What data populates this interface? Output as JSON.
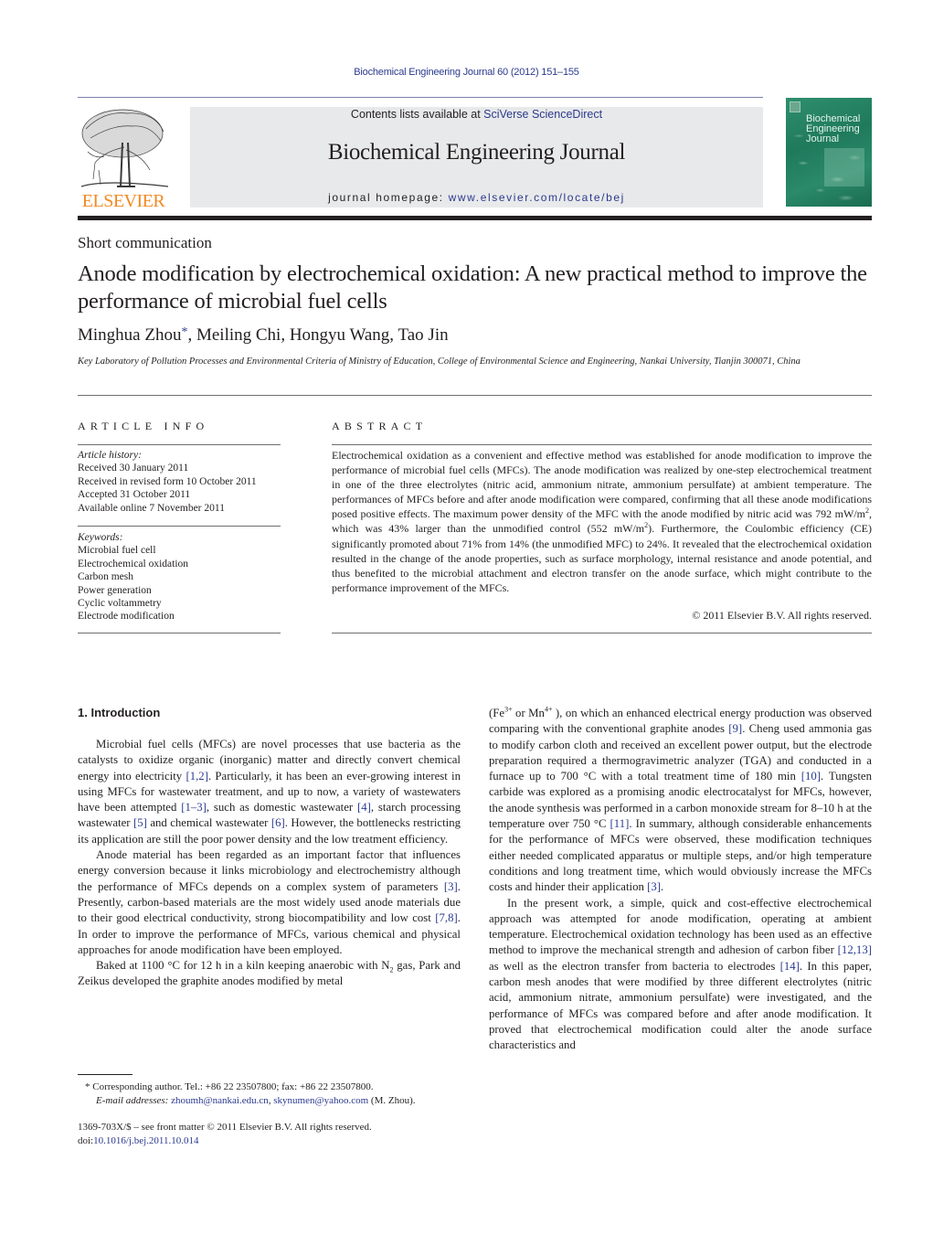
{
  "running_head": "Biochemical Engineering Journal 60 (2012) 151–155",
  "masthead": {
    "contents_prefix": "Contents lists available at ",
    "contents_link": "SciVerse ScienceDirect",
    "journal_title": "Biochemical Engineering Journal",
    "homepage_prefix": "journal homepage: ",
    "homepage_link": "www.elsevier.com/locate/bej",
    "publisher_logo_text": "ELSEVIER",
    "cover_title_lines": [
      "Biochemical",
      "Engineering",
      "Journal"
    ]
  },
  "colors": {
    "link": "#2b3a8f",
    "elsevier_orange": "#f08a24",
    "masthead_bg": "#e8e9ea",
    "cover_green": "#1f7a5c"
  },
  "article": {
    "type": "Short communication",
    "title": "Anode modification by electrochemical oxidation: A new practical method to improve the performance of microbial fuel cells",
    "authors_first": "Minghua Zhou",
    "author_mark": "*",
    "authors_rest": ", Meiling Chi, Hongyu Wang, Tao Jin",
    "affiliation": "Key Laboratory of Pollution Processes and Environmental Criteria of Ministry of Education, College of Environmental Science and Engineering, Nankai University, Tianjin 300071, China"
  },
  "article_info": {
    "heading": "ARTICLE INFO",
    "history_label": "Article history:",
    "history": [
      "Received 30 January 2011",
      "Received in revised form 10 October 2011",
      "Accepted 31 October 2011",
      "Available online 7 November 2011"
    ],
    "keywords_label": "Keywords:",
    "keywords": [
      "Microbial fuel cell",
      "Electrochemical oxidation",
      "Carbon mesh",
      "Power generation",
      "Cyclic voltammetry",
      "Electrode modification"
    ]
  },
  "abstract": {
    "heading": "ABSTRACT",
    "text_1": "Electrochemical oxidation as a convenient and effective method was established for anode modification to improve the performance of microbial fuel cells (MFCs). The anode modification was realized by one-step electrochemical treatment in one of the three electrolytes (nitric acid, ammonium nitrate, ammonium persulfate) at ambient temperature. The performances of MFCs before and after anode modification were compared, confirming that all these anode modifications posed positive effects. The maximum power density of the MFC with the anode modified by nitric acid was 792 mW/m",
    "sup_1": "2",
    "text_2": ", which was 43% larger than the unmodified control (552 mW/m",
    "sup_2": "2",
    "text_3": "). Furthermore, the Coulombic efficiency (CE) significantly promoted about 71% from 14% (the unmodified MFC) to 24%. It revealed that the electrochemical oxidation resulted in the change of the anode properties, such as surface morphology, internal resistance and anode potential, and thus benefited to the microbial attachment and electron transfer on the anode surface, which might contribute to the performance improvement of the MFCs.",
    "copyright": "© 2011 Elsevier B.V. All rights reserved."
  },
  "introduction": {
    "heading": "1.  Introduction",
    "p1": {
      "a": "Microbial fuel cells (MFCs) are novel processes that use bacteria as the catalysts to oxidize organic (inorganic) matter and directly convert chemical energy into electricity ",
      "r1": "[1,2]",
      "b": ". Particularly, it has been an ever-growing interest in using MFCs for wastewater treatment, and up to now, a variety of wastewaters have been attempted ",
      "r2": "[1–3]",
      "c": ", such as domestic wastewater ",
      "r3": "[4]",
      "d": ", starch processing wastewater ",
      "r4": "[5]",
      "e": " and chemical wastewater ",
      "r5": "[6]",
      "f": ". However, the bottlenecks restricting its application are still the poor power density and the low treatment efficiency."
    },
    "p2": {
      "a": "Anode material has been regarded as an important factor that influences energy conversion because it links microbiology and electrochemistry although the performance of MFCs depends on a complex system of parameters ",
      "r1": "[3]",
      "b": ". Presently, carbon-based materials are the most widely used anode materials due to their good electrical conductivity, strong biocompatibility and low cost ",
      "r2": "[7,8]",
      "c": ". In order to improve the performance of MFCs, various chemical and physical approaches for anode modification have been employed."
    },
    "p3": {
      "a": "Baked at 1100 °C for 12 h in a kiln keeping anaerobic with N",
      "sub": "2",
      "b": " gas, Park and Zeikus developed the graphite anodes modified by metal (Fe",
      "sup1": "3+",
      "c": " or Mn",
      "sup2": "4+",
      "d": " ), on which an enhanced electrical energy production was observed comparing with the conventional graphite anodes ",
      "r1": "[9]",
      "e": ". Cheng used ammonia gas to modify carbon cloth and received an excellent power output, but the electrode preparation required a thermogravimetric analyzer (TGA) and conducted in a furnace up to 700 °C with a total treatment time of 180 min ",
      "r2": "[10]",
      "f": ". Tungsten carbide was explored as a promising anodic electrocatalyst for MFCs, however, the anode synthesis was performed in a carbon monoxide stream for 8–10 h at the temperature over 750 °C ",
      "r3": "[11]",
      "g": ". In summary, although considerable enhancements for the performance of MFCs were observed, these modification techniques either needed complicated apparatus or multiple steps, and/or high temperature conditions and long treatment time, which would obviously increase the MFCs costs and hinder their application ",
      "r4": "[3]",
      "h": "."
    },
    "p4": {
      "a": "In the present work, a simple, quick and cost-effective electrochemical approach was attempted for anode modification, operating at ambient temperature. Electrochemical oxidation technology has been used as an effective method to improve the mechanical strength and adhesion of carbon fiber ",
      "r1": "[12,13]",
      "b": " as well as the electron transfer from bacteria to electrodes ",
      "r2": "[14]",
      "c": ". In this paper, carbon mesh anodes that were modified by three different electrolytes (nitric acid, ammonium nitrate, ammonium persulfate) were investigated, and the performance of MFCs was compared before and after anode modification. It proved that electrochemical modification could alter the anode surface characteristics and"
    }
  },
  "footnote": {
    "mark": "*",
    "line1": " Corresponding author. Tel.: +86 22 23507800; fax: +86 22 23507800.",
    "email_label": "E-mail addresses:",
    "email1": "zhoumh@nankai.edu.cn",
    "sep": ", ",
    "email2": "skynumen@yahoo.com",
    "email_suffix": " (M. Zhou)."
  },
  "front_matter": {
    "issn_line": "1369-703X/$ – see front matter © 2011 Elsevier B.V. All rights reserved.",
    "doi_prefix": "doi:",
    "doi": "10.1016/j.bej.2011.10.014"
  }
}
